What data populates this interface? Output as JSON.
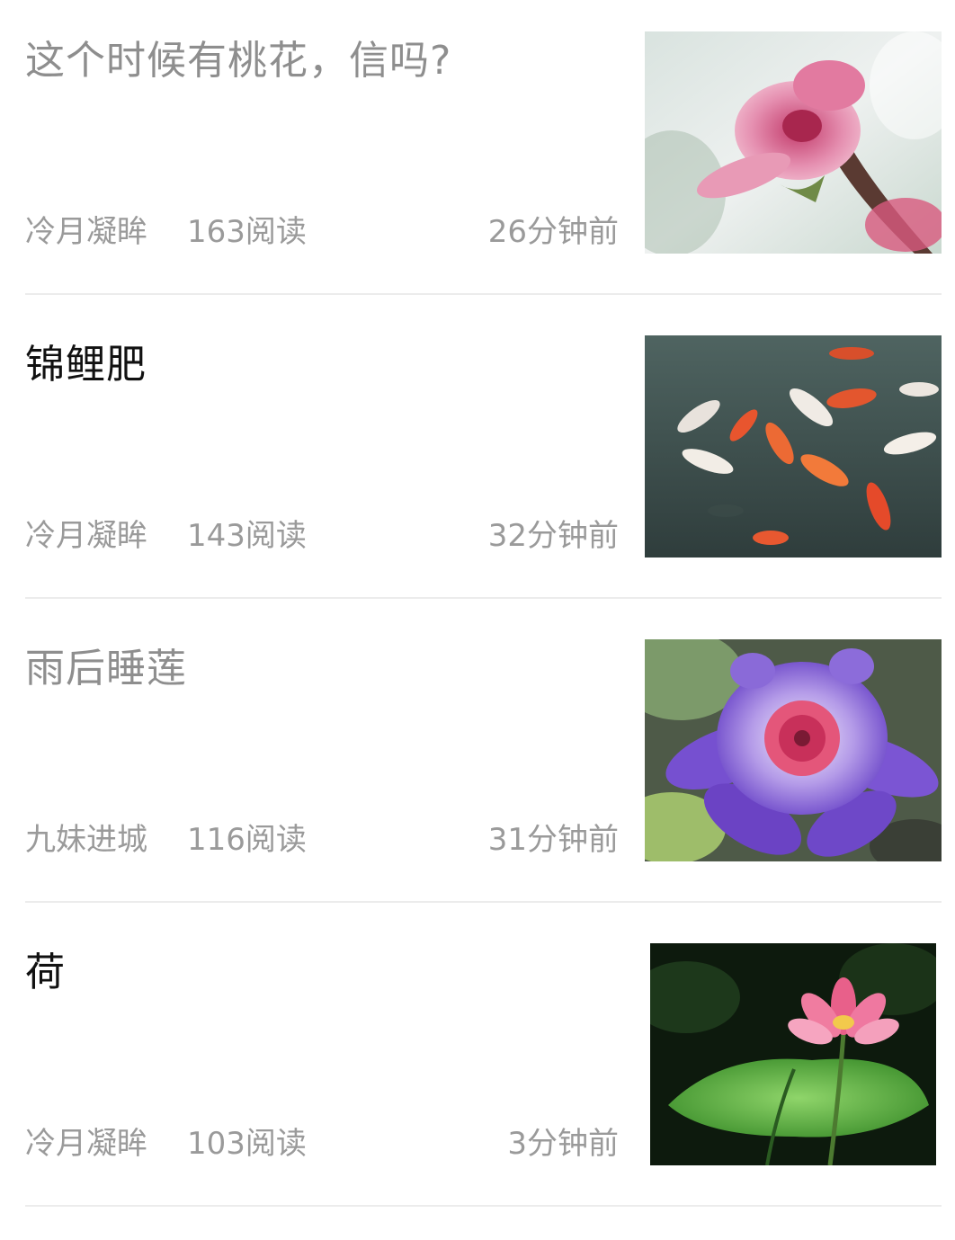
{
  "articles": [
    {
      "title": "这个时候有桃花，信吗?",
      "author": "冷月凝眸",
      "reads": "163阅读",
      "time": "26分钟前",
      "read": true,
      "thumb_icon": "peach-blossom-image"
    },
    {
      "title": "锦鲤肥",
      "author": "冷月凝眸",
      "reads": "143阅读",
      "time": "32分钟前",
      "read": false,
      "thumb_icon": "koi-fish-image"
    },
    {
      "title": "雨后睡莲",
      "author": "九妹进城",
      "reads": "116阅读",
      "time": "31分钟前",
      "read": true,
      "thumb_icon": "water-lily-image"
    },
    {
      "title": "荷",
      "author": "冷月凝眸",
      "reads": "103阅读",
      "time": "3分钟前",
      "read": false,
      "thumb_icon": "lotus-image"
    }
  ],
  "colors": {
    "title_read": "#8e8e8e",
    "title_unread": "#111111",
    "meta_text": "#9a9a9a",
    "divider": "#ececec"
  }
}
